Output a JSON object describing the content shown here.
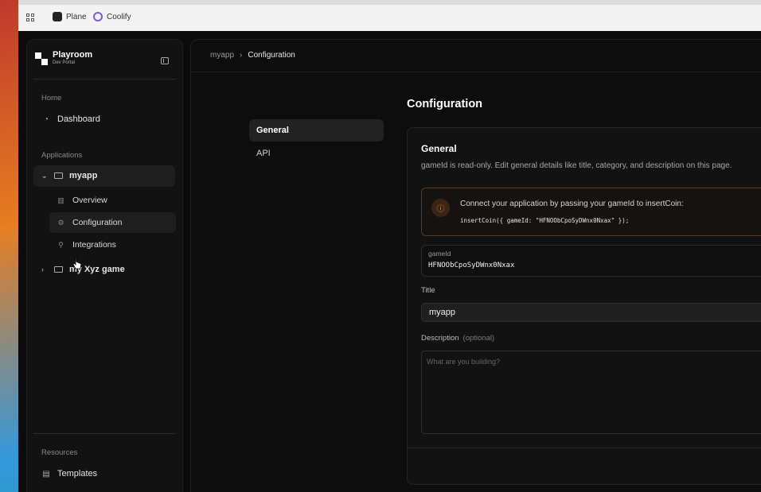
{
  "bookmarks": [
    {
      "label": "Plane",
      "color": "#222222"
    },
    {
      "label": "Coolify",
      "color": "#7c5cd6"
    }
  ],
  "brand": {
    "name": "Playroom",
    "sub": "Dev Portal"
  },
  "sidebar": {
    "home_label": "Home",
    "dashboard": "Dashboard",
    "applications_label": "Applications",
    "apps": [
      {
        "name": "myapp",
        "children": [
          "Overview",
          "Configuration",
          "Integrations"
        ]
      },
      {
        "name": "my Xyz game"
      }
    ],
    "resources_label": "Resources",
    "templates": "Templates"
  },
  "breadcrumb": {
    "parent": "myapp",
    "current": "Configuration"
  },
  "page": {
    "title": "Configuration",
    "tabs": [
      "General",
      "API"
    ]
  },
  "general": {
    "title": "General",
    "description": "gameId is read-only. Edit general details like title, category, and description on this page.",
    "notice_text": "Connect your application by passing your gameId to insertCoin:",
    "notice_code": "insertCoin({ gameId: \"HFNOObCpoSyDWnx0Nxax\" });",
    "gameid_label": "gameId",
    "gameid_value": "HFNOObCpoSyDWnx0Nxax",
    "title_label": "Title",
    "title_value": "myapp",
    "description_label": "Description",
    "description_optional": "(optional)",
    "description_placeholder": "What are you building?"
  },
  "colors": {
    "accent": "#e08a3a",
    "background": "#0b0b0b"
  }
}
